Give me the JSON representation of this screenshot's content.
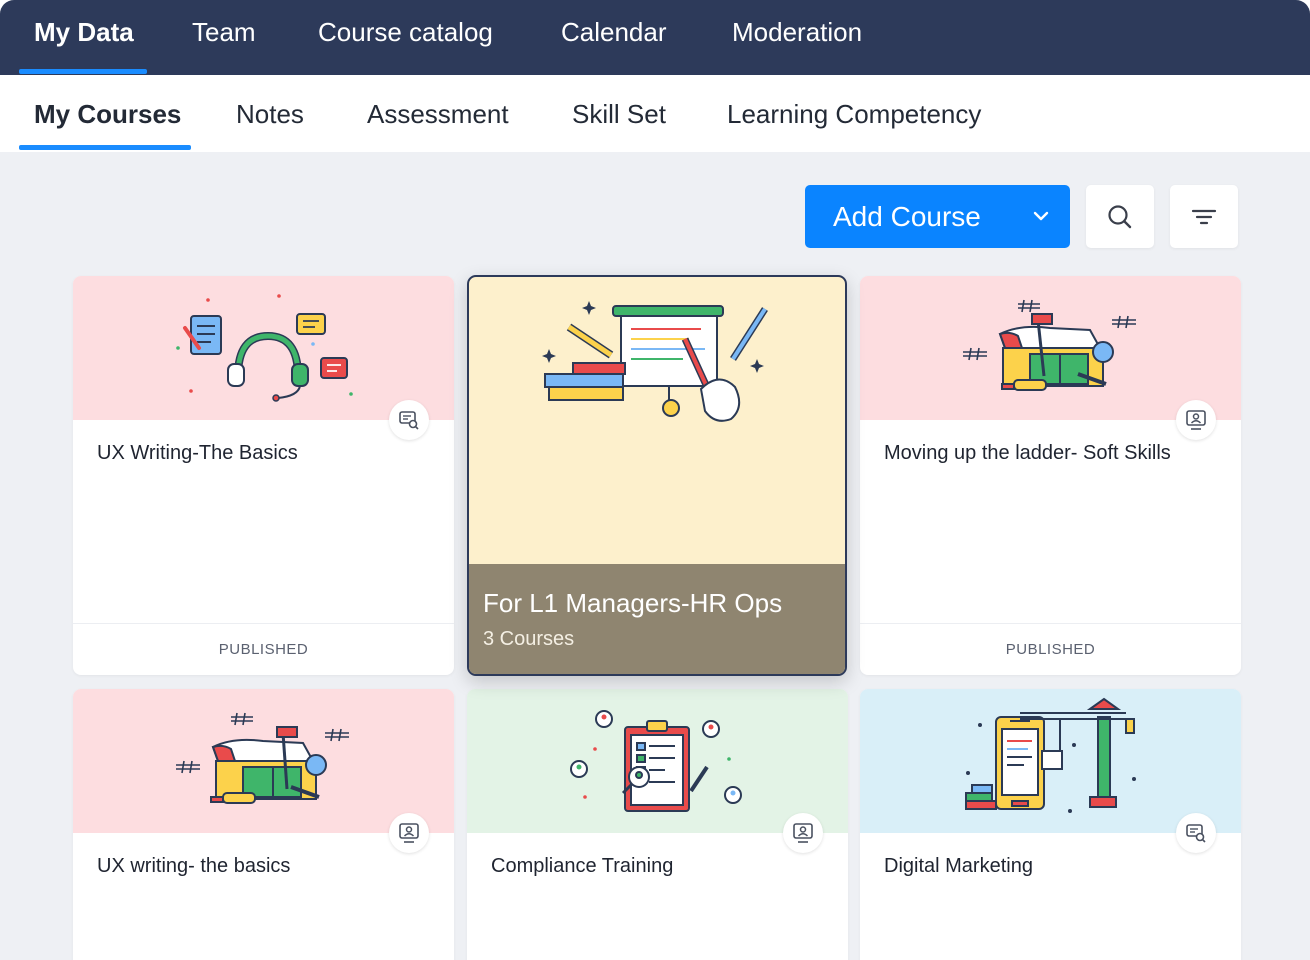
{
  "top_nav": {
    "tabs": [
      {
        "label": "My Data",
        "active": true
      },
      {
        "label": "Team"
      },
      {
        "label": "Course catalog"
      },
      {
        "label": "Calendar"
      },
      {
        "label": "Moderation"
      }
    ]
  },
  "sub_nav": {
    "tabs": [
      {
        "label": "My Courses",
        "active": true
      },
      {
        "label": "Notes"
      },
      {
        "label": "Assessment"
      },
      {
        "label": "Skill Set"
      },
      {
        "label": "Learning Competency"
      }
    ]
  },
  "toolbar": {
    "add_course_label": "Add Course",
    "icons": [
      "chevron-down-icon",
      "search-icon",
      "filter-icon"
    ]
  },
  "cards": [
    {
      "title": "UX Writing-The Basics",
      "status": "PUBLISHED",
      "banner_color": "#fddde0",
      "illustration": "support-headset",
      "badge_icon": "course-search-icon"
    },
    {
      "title": "For L1 Managers-HR Ops",
      "subtitle": "3 Courses",
      "banner_color": "#fdf0cc",
      "illustration": "presentation-board",
      "highlighted": true
    },
    {
      "title": "Moving up the ladder- Soft Skills",
      "status": "PUBLISHED",
      "banner_color": "#fddde0",
      "illustration": "toolbox",
      "badge_icon": "presenter-icon"
    },
    {
      "title": "UX writing- the basics",
      "banner_color": "#fddde0",
      "illustration": "toolbox",
      "badge_icon": "presenter-icon"
    },
    {
      "title": "Compliance Training",
      "banner_color": "#e3f3e6",
      "illustration": "clipboard-checklist",
      "badge_icon": "presenter-icon"
    },
    {
      "title": "Digital Marketing",
      "banner_color": "#d9eff8",
      "illustration": "phone-crane",
      "badge_icon": "course-search-icon"
    }
  ],
  "colors": {
    "nav_bg": "#2d3a5a",
    "accent": "#0a84ff",
    "page_bg": "#eef0f4"
  }
}
